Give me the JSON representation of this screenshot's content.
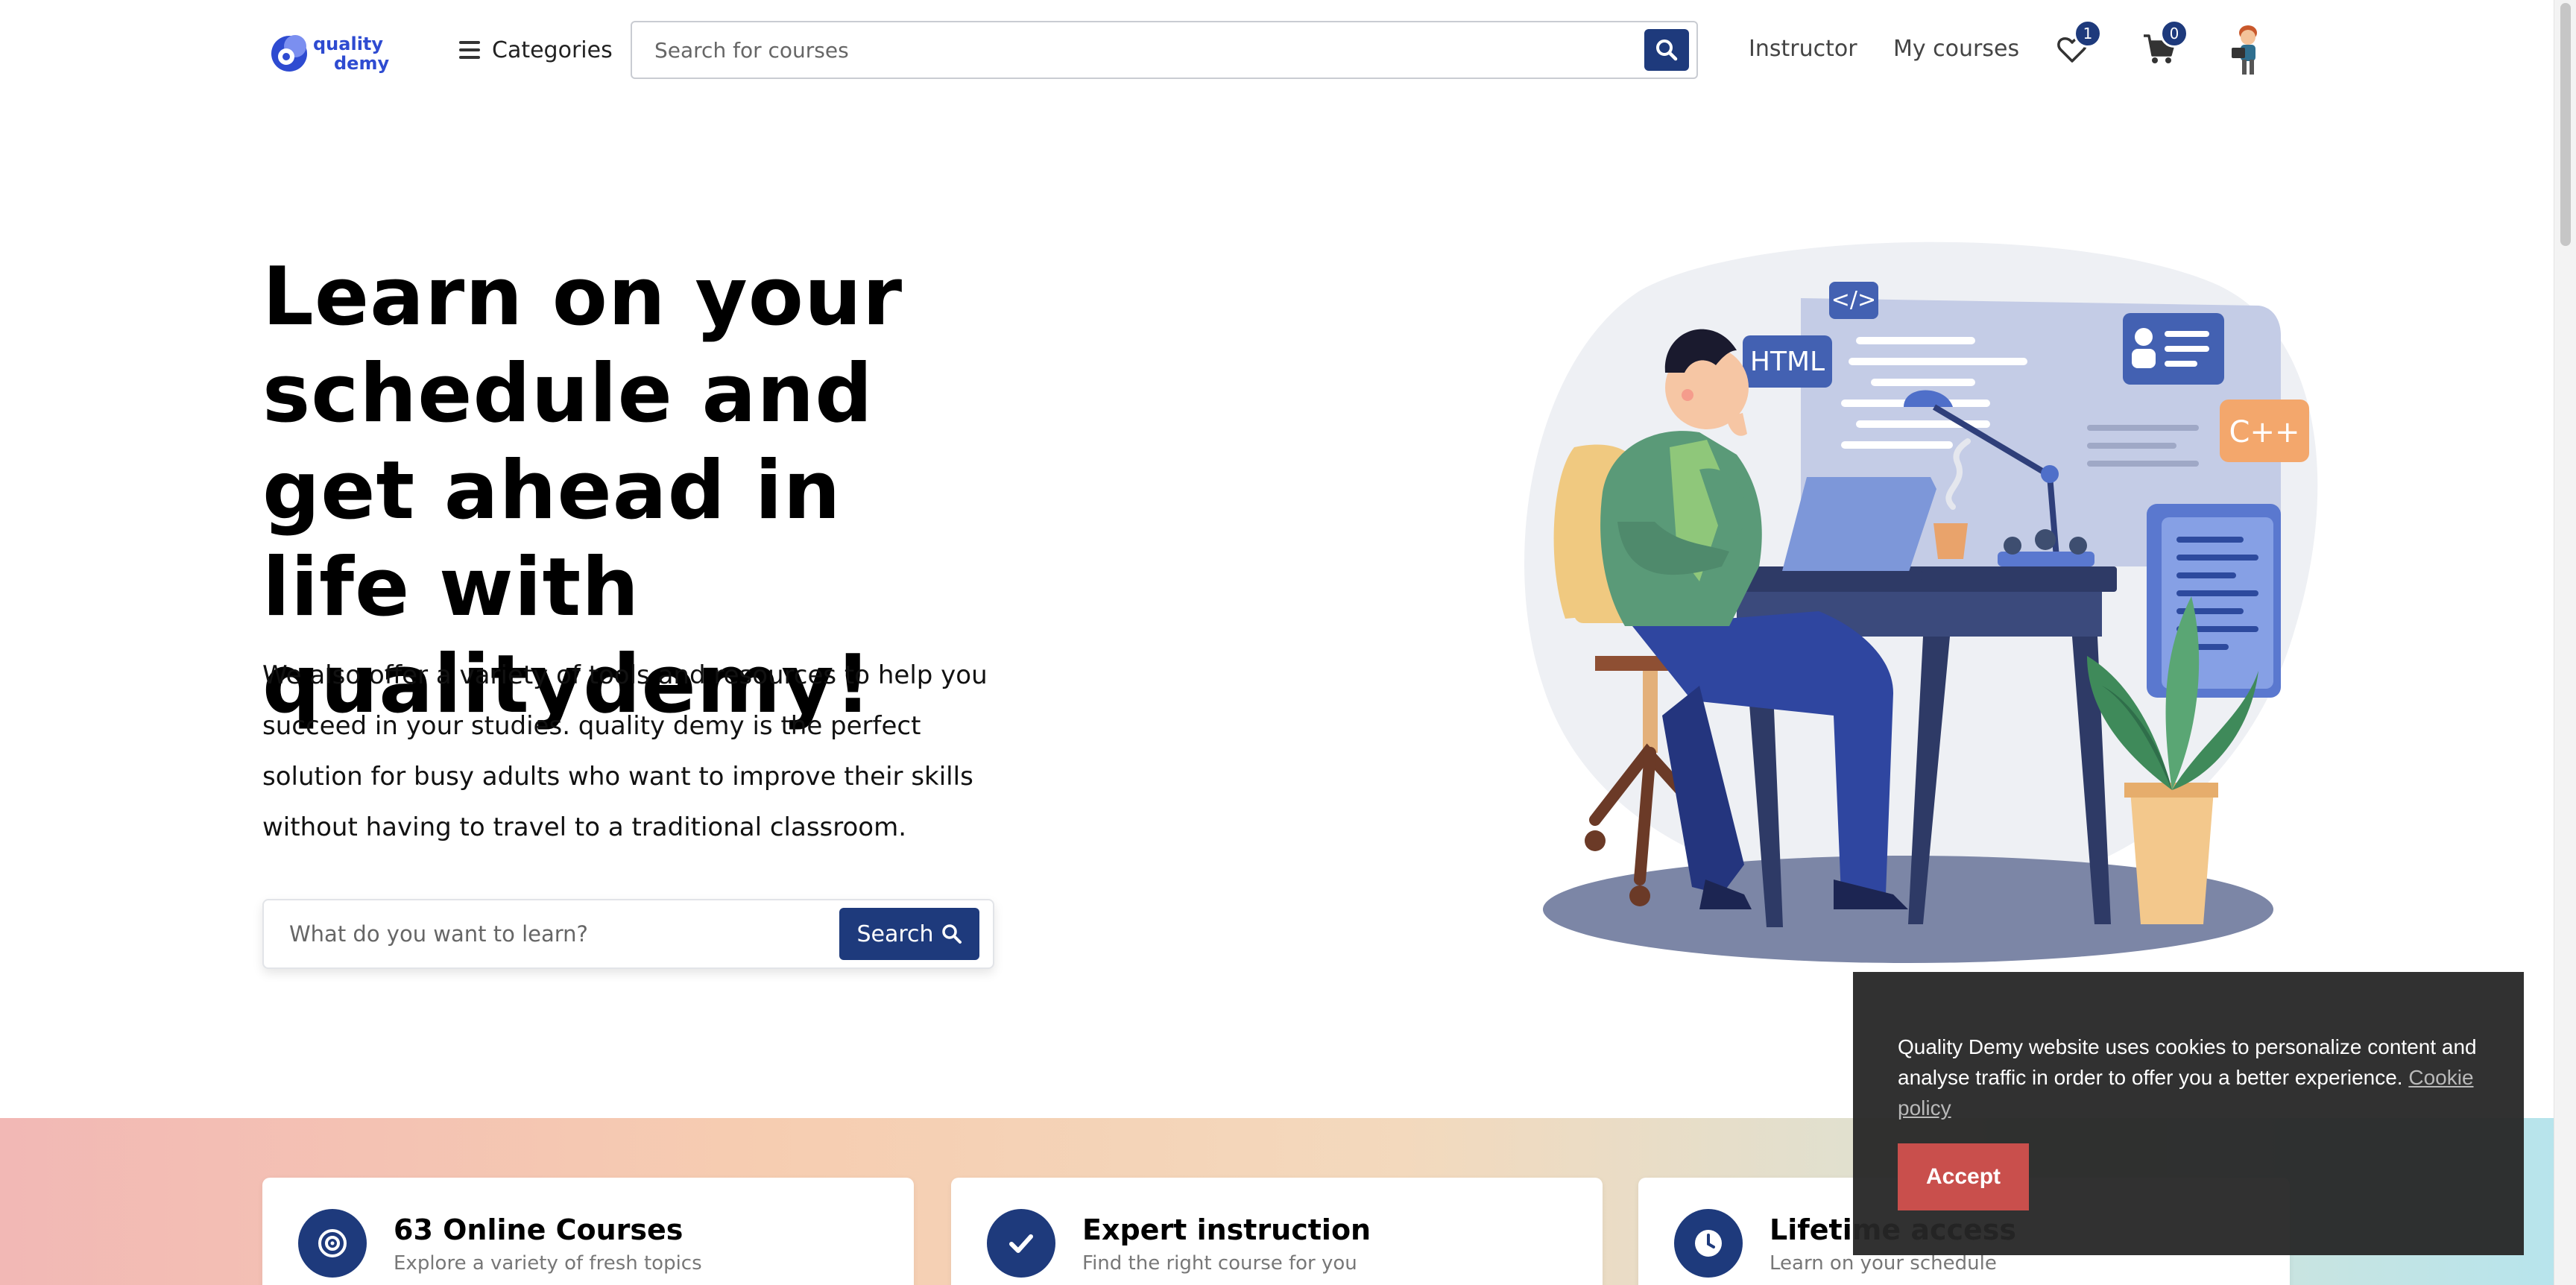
{
  "header": {
    "logo_line1": "quality",
    "logo_line2": "demy",
    "categories_label": "Categories",
    "search_placeholder": "Search for courses",
    "nav_instructor": "Instructor",
    "nav_my_courses": "My courses",
    "wishlist_count": "1",
    "cart_count": "0"
  },
  "hero": {
    "title": "Learn on your schedule and get ahead in life with qualitydemy!",
    "description": "We also offer a variety of tools and resources to help you succeed in your studies. quality demy is the perfect solution for busy adults who want to improve their skills without having to travel to a traditional classroom.",
    "search_placeholder": "What do you want to learn?",
    "search_button": "Search"
  },
  "illustration": {
    "tag_html": "HTML",
    "tag_code": "</>",
    "tag_cpp": "C++"
  },
  "features": [
    {
      "title": "63 Online Courses",
      "subtitle": "Explore a variety of fresh topics",
      "icon": "target-icon"
    },
    {
      "title": "Expert instruction",
      "subtitle": "Find the right course for you",
      "icon": "check-icon"
    },
    {
      "title": "Lifetime access",
      "subtitle": "Learn on your schedule",
      "icon": "clock-icon"
    }
  ],
  "cookie": {
    "message": "Quality Demy website uses cookies to personalize content and analyse traffic in order to offer you a better experience.",
    "link": "Cookie policy",
    "accept": "Accept"
  },
  "colors": {
    "primary": "#1e3a7c",
    "accept": "#c94f4c",
    "logo": "#2e4bd1"
  }
}
